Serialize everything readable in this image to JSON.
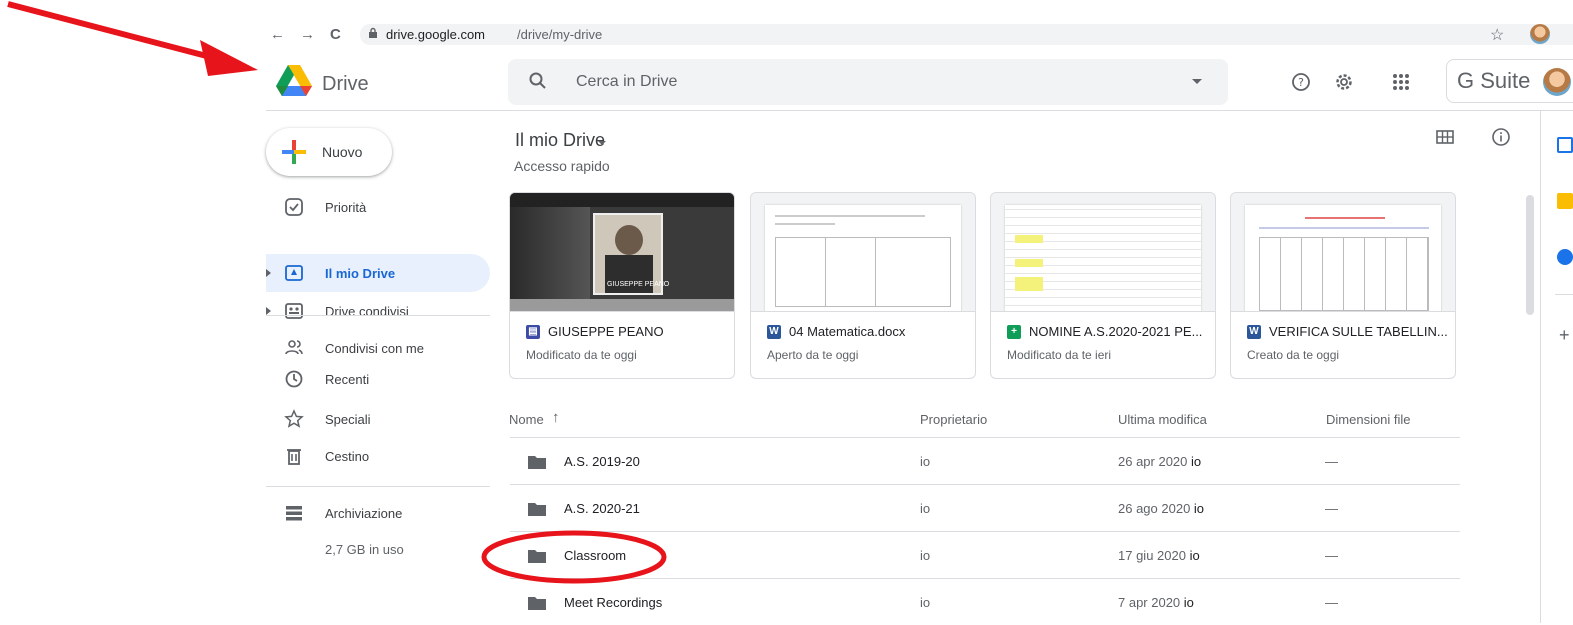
{
  "browser": {
    "url_host": "drive.google.com",
    "url_path": "/drive/my-drive"
  },
  "header": {
    "app_name": "Drive",
    "search_placeholder": "Cerca in Drive",
    "gsuite_label": "G Suite"
  },
  "sidebar": {
    "new_label": "Nuovo",
    "items": [
      {
        "label": "Priorità",
        "icon": "priority-icon"
      },
      {
        "label": "Il mio Drive",
        "icon": "my-drive-icon",
        "active": true
      },
      {
        "label": "Drive condivisi",
        "icon": "shared-drives-icon"
      },
      {
        "label": "Condivisi con me",
        "icon": "people-icon"
      },
      {
        "label": "Recenti",
        "icon": "clock-icon"
      },
      {
        "label": "Speciali",
        "icon": "star-icon"
      },
      {
        "label": "Cestino",
        "icon": "trash-icon"
      },
      {
        "label": "Archiviazione",
        "icon": "storage-icon"
      }
    ],
    "storage_used": "2,7 GB in uso"
  },
  "main": {
    "breadcrumb": "Il mio Drive",
    "quick_access_label": "Accesso rapido",
    "quick_access": [
      {
        "title": "GIUSEPPE PEANO",
        "subtitle": "Modificato da te oggi",
        "type": "site",
        "color": "#3c4ba6",
        "thumb_caption": "GIUSEPPE PEANO"
      },
      {
        "title": "04 Matematica.docx",
        "subtitle": "Aperto da te oggi",
        "type": "word",
        "color": "#2b579a"
      },
      {
        "title": "NOMINE A.S.2020-2021 PE...",
        "subtitle": "Modificato da te ieri",
        "type": "sheets",
        "color": "#0f9d58"
      },
      {
        "title": "VERIFICA SULLE TABELLIN...",
        "subtitle": "Creato da te oggi",
        "type": "word",
        "color": "#2b579a"
      }
    ],
    "columns": {
      "name": "Nome",
      "owner": "Proprietario",
      "modified": "Ultima modifica",
      "size": "Dimensioni file"
    },
    "files": [
      {
        "name": "A.S. 2019-20",
        "owner": "io",
        "modified": "26 apr 2020",
        "modified_by": "io",
        "size": "—"
      },
      {
        "name": "A.S. 2020-21",
        "owner": "io",
        "modified": "26 ago 2020",
        "modified_by": "io",
        "size": "—"
      },
      {
        "name": "Classroom",
        "owner": "io",
        "modified": "17 giu 2020",
        "modified_by": "io",
        "size": "—"
      },
      {
        "name": "Meet Recordings",
        "owner": "io",
        "modified": "7 apr 2020",
        "modified_by": "io",
        "size": "—"
      }
    ]
  },
  "colors": {
    "accent": "#1967d2",
    "active_bg": "#e8f0fe",
    "annotation": "#e8141b"
  }
}
